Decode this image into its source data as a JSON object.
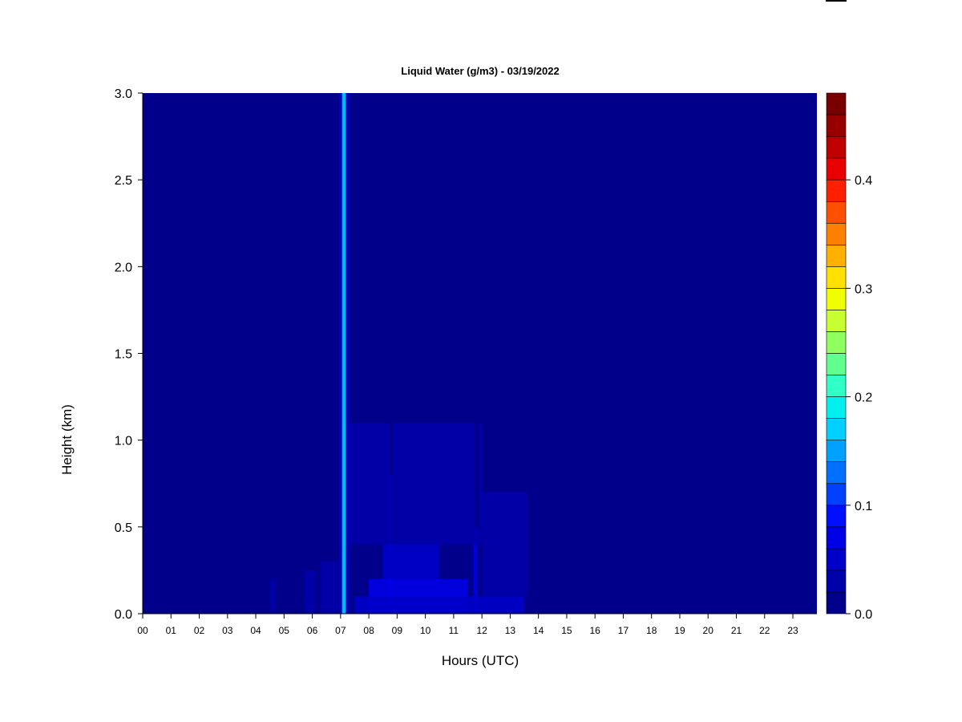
{
  "chart_data": {
    "type": "heatmap",
    "title": "Liquid Water (g/m3) - 03/19/2022",
    "xlabel": "Hours (UTC)",
    "ylabel": "Height (km)",
    "x_tick_labels": [
      "00",
      "01",
      "02",
      "03",
      "04",
      "05",
      "06",
      "07",
      "08",
      "09",
      "10",
      "11",
      "12",
      "13",
      "14",
      "15",
      "16",
      "17",
      "18",
      "19",
      "20",
      "21",
      "22",
      "23"
    ],
    "x_range_hours": [
      0,
      23.85
    ],
    "y_ticks": [
      "0.0",
      "0.5",
      "1.0",
      "1.5",
      "2.0",
      "2.5",
      "3.0"
    ],
    "y_range_km": [
      0,
      3.0
    ],
    "colorbar": {
      "range": [
        0,
        0.48
      ],
      "tick_labels": [
        "0.0",
        "0.1",
        "0.2",
        "0.3",
        "0.4"
      ],
      "tick_values": [
        0,
        0.1,
        0.2,
        0.3,
        0.4
      ],
      "colors": [
        "#00008b",
        "#0000a8",
        "#0000c8",
        "#0000e6",
        "#0010ff",
        "#0040ff",
        "#0070ff",
        "#00a0ff",
        "#00d0ff",
        "#00f0f0",
        "#30ffc8",
        "#60ff90",
        "#90ff60",
        "#c8ff30",
        "#f0ff00",
        "#ffe000",
        "#ffb000",
        "#ff8000",
        "#ff5000",
        "#ff2000",
        "#e80000",
        "#c00000",
        "#980000",
        "#780000"
      ]
    },
    "background_value": 0.0,
    "cells": [
      {
        "h0": 7.05,
        "h1": 7.18,
        "z0": 0.0,
        "z1": 3.0,
        "v": 0.16
      },
      {
        "h0": 6.95,
        "h1": 7.05,
        "z0": 0.0,
        "z1": 3.0,
        "v": 0.05
      },
      {
        "h0": 7.18,
        "h1": 7.3,
        "z0": 0.0,
        "z1": 3.0,
        "v": 0.05
      },
      {
        "h0": 8.65,
        "h1": 8.8,
        "z0": 0.0,
        "z1": 0.8,
        "v": 0.07
      },
      {
        "h0": 11.7,
        "h1": 11.85,
        "z0": 0.0,
        "z1": 0.5,
        "v": 0.06
      },
      {
        "h0": 8.0,
        "h1": 11.5,
        "z0": 0.0,
        "z1": 0.2,
        "v": 0.06
      },
      {
        "h0": 8.5,
        "h1": 10.5,
        "z0": 0.2,
        "z1": 0.4,
        "v": 0.04
      },
      {
        "h0": 7.5,
        "h1": 13.5,
        "z0": 0.0,
        "z1": 0.1,
        "v": 0.04
      },
      {
        "h0": 6.3,
        "h1": 6.9,
        "z0": 0.0,
        "z1": 0.3,
        "v": 0.03
      },
      {
        "h0": 5.7,
        "h1": 6.1,
        "z0": 0.0,
        "z1": 0.25,
        "v": 0.02
      },
      {
        "h0": 4.5,
        "h1": 4.7,
        "z0": 0.0,
        "z1": 0.2,
        "v": 0.02
      },
      {
        "h0": 7.3,
        "h1": 12.0,
        "z0": 0.4,
        "z1": 1.1,
        "v": 0.02
      },
      {
        "h0": 12.0,
        "h1": 13.6,
        "z0": 0.1,
        "z1": 0.7,
        "v": 0.02
      },
      {
        "h0": 11.75,
        "h1": 11.9,
        "z0": 0.5,
        "z1": 3.0,
        "v": 0.015
      },
      {
        "h0": 12.9,
        "h1": 13.0,
        "z0": 0.7,
        "z1": 3.0,
        "v": 0.012
      },
      {
        "h0": 8.7,
        "h1": 8.85,
        "z0": 0.8,
        "z1": 3.0,
        "v": 0.015
      },
      {
        "h0": 7.6,
        "h1": 8.2,
        "z0": 1.1,
        "z1": 3.0,
        "v": 0.01
      },
      {
        "h0": 23.0,
        "h1": 23.5,
        "z0": 0.0,
        "z1": 3.0,
        "v": 0.008
      }
    ]
  }
}
